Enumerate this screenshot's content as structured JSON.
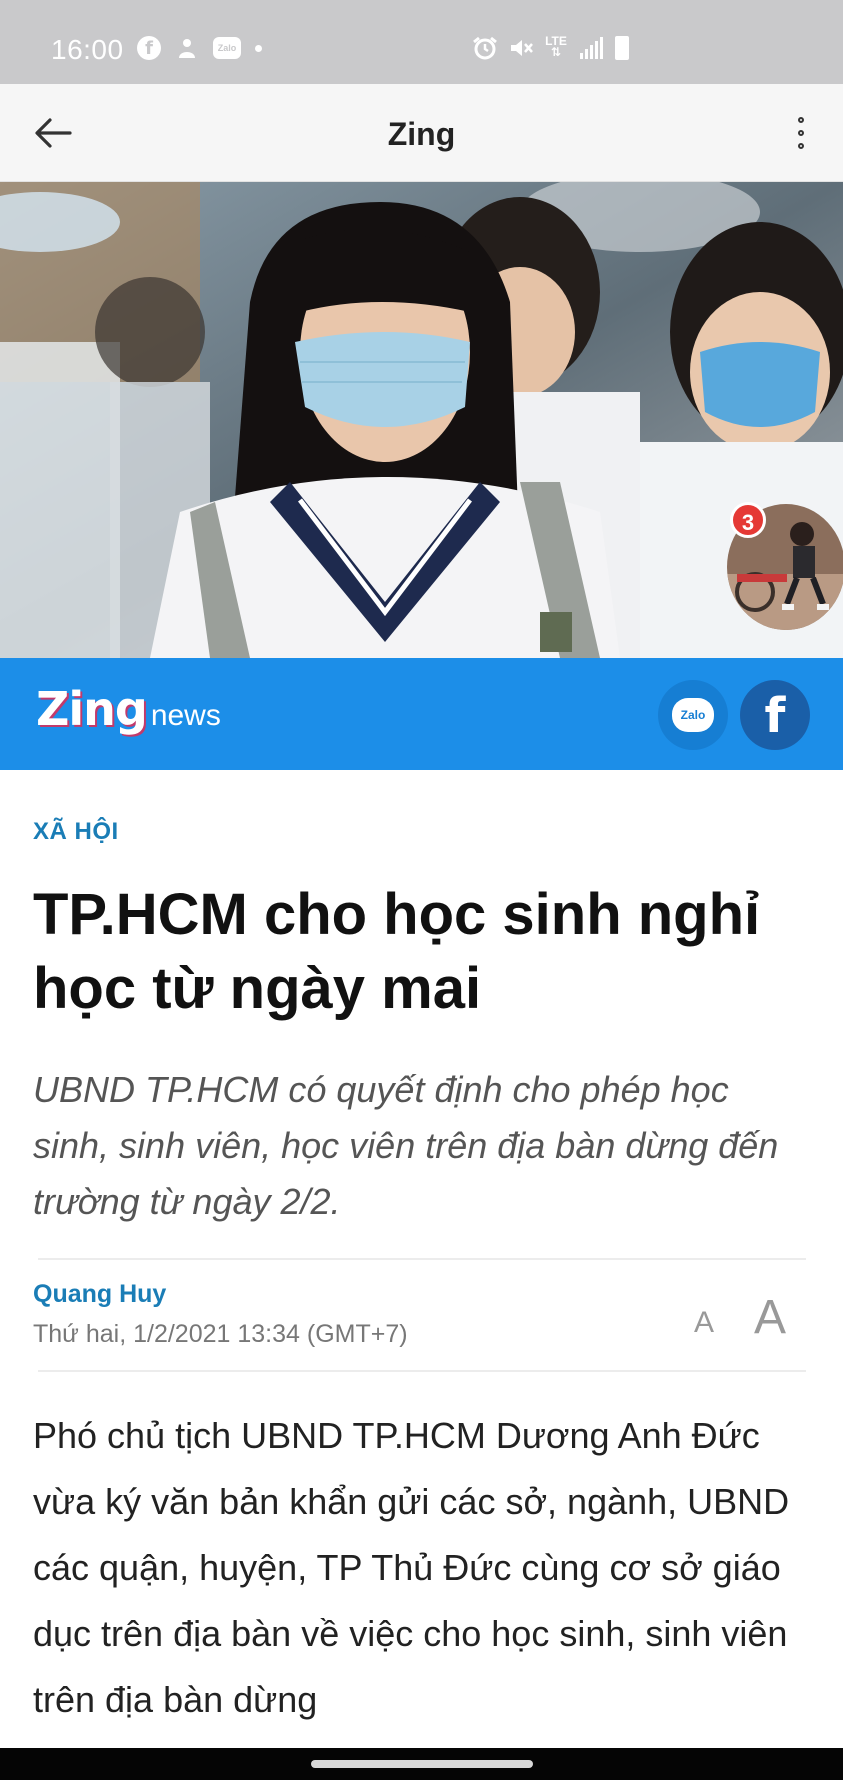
{
  "status_bar": {
    "time": "16:00",
    "left_icons": [
      "facebook-icon",
      "messenger-icon",
      "zalo-icon",
      "dot-icon"
    ],
    "zalo_text": "Zalo",
    "lte_text": "LTE",
    "right_icons": [
      "alarm-icon",
      "mute-icon",
      "lte-icon",
      "signal-icon",
      "battery-icon"
    ]
  },
  "app_bar": {
    "title": "Zing",
    "back_icon": "arrow-left-icon",
    "menu_icon": "more-vertical-icon"
  },
  "chat_head": {
    "badge_count": "3"
  },
  "banner": {
    "brand_main": "Zing",
    "brand_sub": "news",
    "share_zalo_label": "Zalo",
    "share_facebook_label": "f",
    "color": "#1c8ee8"
  },
  "article": {
    "category": "XÃ HỘI",
    "headline": "TP.HCM cho học sinh nghỉ học từ ngày mai",
    "sapo": "UBND TP.HCM có quyết định cho phép học sinh, sinh viên, học viên trên địa bàn dừng đến trường từ ngày 2/2.",
    "author": "Quang Huy",
    "date": "Thứ hai, 1/2/2021 13:34 (GMT+7)",
    "font_small_label": "A",
    "font_large_label": "A",
    "body": "Phó chủ tịch UBND TP.HCM Dương Anh Đức vừa ký văn bản khẩn gửi các sở, ngành, UBND các quận, huyện, TP Thủ Đức cùng cơ sở giáo dục trên địa bàn về việc cho học sinh, sinh viên trên địa bàn dừng"
  },
  "colors": {
    "accent": "#1a7db6",
    "status_bar": "#c9c9cb",
    "badge": "#e53935"
  }
}
